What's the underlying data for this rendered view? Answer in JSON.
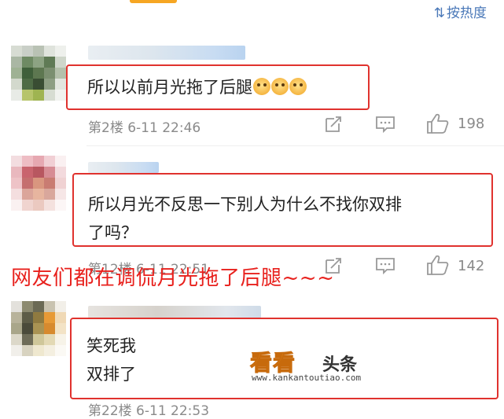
{
  "sort": {
    "label": "按热度",
    "icon": "sort-arrows-icon"
  },
  "caption": "网友们都在调侃月光拖了后腿~~~",
  "watermark": {
    "brand": "看看",
    "brand2": "头条",
    "url": "www.kankantoutiao.com"
  },
  "comments": [
    {
      "text": "所以以前月光拖了后腿",
      "emoji_count": 3,
      "floor": "第2楼",
      "time": "6-11 22:46",
      "likes": "198"
    },
    {
      "text_line1": "所以月光不反思一下别人为什么不找你双排",
      "text_line2": "了吗？",
      "floor": "第12楼",
      "time": "6-11 22:51",
      "likes": "142"
    },
    {
      "text_line1": "笑死我",
      "text_line2": "双排了",
      "floor": "第22楼",
      "time": "6-11 22:53"
    }
  ],
  "colors": {
    "highlight_border": "#e0322e",
    "caption": "#e8211d",
    "link_blue": "#4a78b8",
    "meta_gray": "#8a8a8a"
  }
}
